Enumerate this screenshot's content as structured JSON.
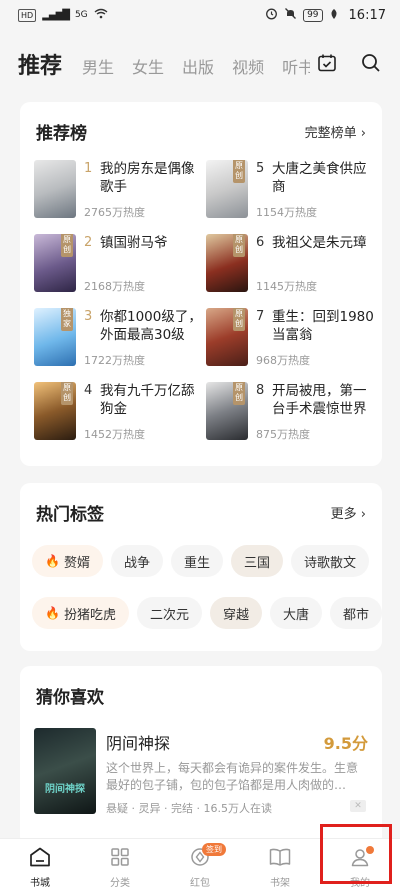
{
  "status_bar": {
    "left": [
      "HD",
      "5G"
    ],
    "battery": "99",
    "time": "16:17"
  },
  "top_nav": {
    "tabs": [
      "推荐",
      "男生",
      "女生",
      "出版",
      "视频",
      "听书"
    ],
    "active": "推荐",
    "icons": [
      "calendar-check-icon",
      "search-icon"
    ]
  },
  "ranking": {
    "title": "推荐榜",
    "more": "完整榜单 ›",
    "items": [
      {
        "rank": "1",
        "title": "我的房东是偶像歌手",
        "heat": "2765万热度",
        "cover_tag": ""
      },
      {
        "rank": "2",
        "title": "镇国驸马爷",
        "heat": "2168万热度",
        "cover_tag": "原创"
      },
      {
        "rank": "3",
        "title": "你都1000级了，外面最高30级",
        "heat": "1722万热度",
        "cover_tag": "独家"
      },
      {
        "rank": "4",
        "title": "我有九千万亿舔狗金",
        "heat": "1452万热度",
        "cover_tag": "原创"
      },
      {
        "rank": "5",
        "title": "大唐之美食供应商",
        "heat": "1154万热度",
        "cover_tag": "原创"
      },
      {
        "rank": "6",
        "title": "我祖父是朱元璋",
        "heat": "1145万热度",
        "cover_tag": "原创"
      },
      {
        "rank": "7",
        "title": "重生：回到1980当富翁",
        "heat": "968万热度",
        "cover_tag": "原创"
      },
      {
        "rank": "8",
        "title": "开局被甩，第一台手术震惊世界",
        "heat": "875万热度",
        "cover_tag": "原创"
      }
    ]
  },
  "tags": {
    "title": "热门标签",
    "more": "更多 ›",
    "row1": [
      {
        "label": "赘婿",
        "hot": true
      },
      {
        "label": "战争",
        "hot": false
      },
      {
        "label": "重生",
        "hot": false
      },
      {
        "label": "三国",
        "hot": false,
        "selected": true
      },
      {
        "label": "诗歌散文",
        "hot": false
      }
    ],
    "row2": [
      {
        "label": "扮猪吃虎",
        "hot": true
      },
      {
        "label": "二次元",
        "hot": false
      },
      {
        "label": "穿越",
        "hot": false,
        "selected": true
      },
      {
        "label": "大唐",
        "hot": false
      },
      {
        "label": "都市",
        "hot": false
      }
    ]
  },
  "guess": {
    "title": "猜你喜欢",
    "book": {
      "title": "阴间神探",
      "score": "9.5分",
      "desc": "这个世界上，每天都会有诡异的案件发生。生意最好的包子铺，包的包子馅都是用人肉做的…",
      "meta": "悬疑 · 灵异 · 完结 · 16.5万人在读",
      "cover_text": "阴间神探"
    }
  },
  "bottom_nav": {
    "items": [
      {
        "label": "书城",
        "icon": "home-icon",
        "active": true
      },
      {
        "label": "分类",
        "icon": "grid-icon",
        "active": false
      },
      {
        "label": "红包",
        "icon": "coin-icon",
        "active": false,
        "badge": "签到"
      },
      {
        "label": "书架",
        "icon": "book-icon",
        "active": false
      },
      {
        "label": "我的",
        "icon": "user-icon",
        "active": false,
        "dot": true
      }
    ]
  },
  "colors": {
    "accent": "#f0793a",
    "gold": "#c9a46a",
    "highlight": "#e0201c"
  }
}
